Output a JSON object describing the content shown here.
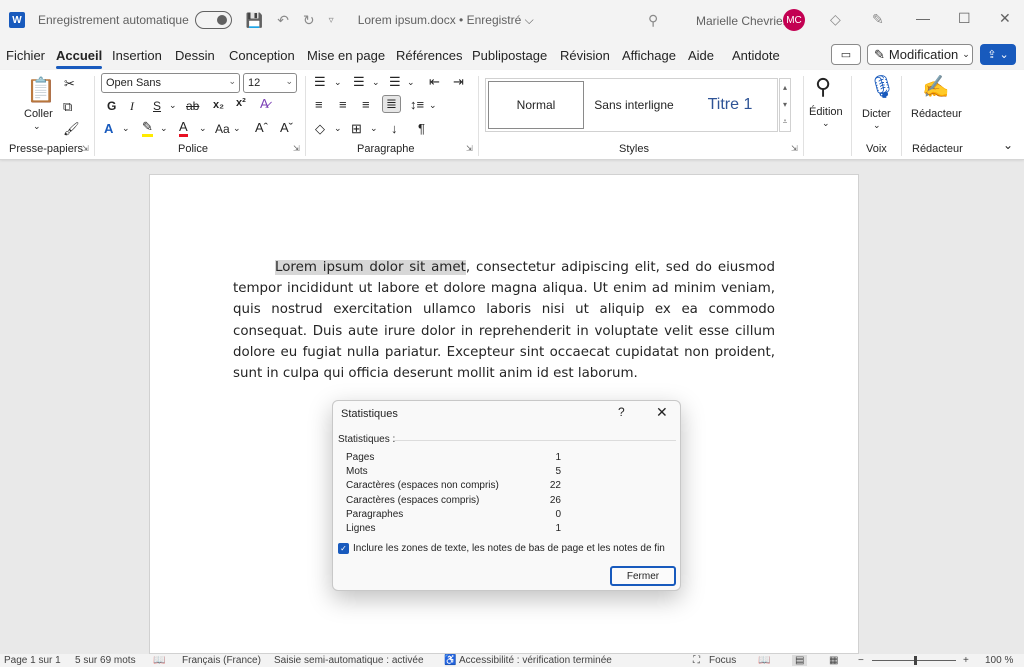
{
  "titlebar": {
    "autosave_label": "Enregistrement automatique",
    "doc_title": "Lorem ipsum.docx • Enregistré ⌵",
    "user_name": "Marielle Chevrier",
    "user_initials": "MC"
  },
  "menu": {
    "items": [
      "Fichier",
      "Accueil",
      "Insertion",
      "Dessin",
      "Conception",
      "Mise en page",
      "Références",
      "Publipostage",
      "Révision",
      "Affichage",
      "Aide",
      "Antidote"
    ],
    "active": "Accueil",
    "modification_label": "Modification"
  },
  "ribbon": {
    "clipboard": {
      "paste_label": "Coller",
      "group_label": "Presse-papiers"
    },
    "font": {
      "name": "Open Sans",
      "size": "12",
      "group_label": "Police",
      "bold": "G",
      "italic": "I",
      "underline": "S",
      "strike": "ab",
      "subscript": "x₂",
      "superscript": "x²",
      "case": "Aa"
    },
    "paragraph": {
      "group_label": "Paragraphe"
    },
    "styles": {
      "items": [
        "Normal",
        "Sans interligne",
        "Titre 1"
      ],
      "group_label": "Styles"
    },
    "edition_label": "Édition",
    "voice": {
      "dictate_label": "Dicter",
      "group_label": "Voix"
    },
    "redacteur": {
      "label": "Rédacteur",
      "group_label": "Rédacteur"
    }
  },
  "document": {
    "highlighted": "Lorem ipsum dolor sit amet",
    "rest": ", consectetur adipiscing elit, sed do eiusmod tempor incididunt ut labore et dolore magna aliqua. Ut enim ad minim veniam, quis nostrud exercitation ullamco laboris nisi ut aliquip ex ea commodo consequat. Duis aute irure dolor in reprehenderit in voluptate velit esse cillum dolore eu fugiat nulla pariatur. Excepteur sint occaecat cupidatat non proident, sunt in culpa qui officia deserunt mollit anim id est laborum."
  },
  "dialog": {
    "title": "Statistiques",
    "help": "?",
    "section": "Statistiques :",
    "stats": [
      {
        "label": "Pages",
        "value": "1"
      },
      {
        "label": "Mots",
        "value": "5"
      },
      {
        "label": "Caractères (espaces non compris)",
        "value": "22"
      },
      {
        "label": "Caractères (espaces compris)",
        "value": "26"
      },
      {
        "label": "Paragraphes",
        "value": "0"
      },
      {
        "label": "Lignes",
        "value": "1"
      }
    ],
    "checkbox_label": "Inclure les zones de texte, les notes de bas de page et les notes de fin",
    "checkbox_checked": true,
    "close_button": "Fermer"
  },
  "statusbar": {
    "page": "Page 1 sur 1",
    "words": "5 sur 69 mots",
    "language": "Français (France)",
    "autocomplete": "Saisie semi-automatique : activée",
    "accessibility": "Accessibilité : vérification terminée",
    "focus": "Focus",
    "zoom": "100 %"
  },
  "colors": {
    "accent": "#185abd",
    "avatar": "#c30052"
  }
}
